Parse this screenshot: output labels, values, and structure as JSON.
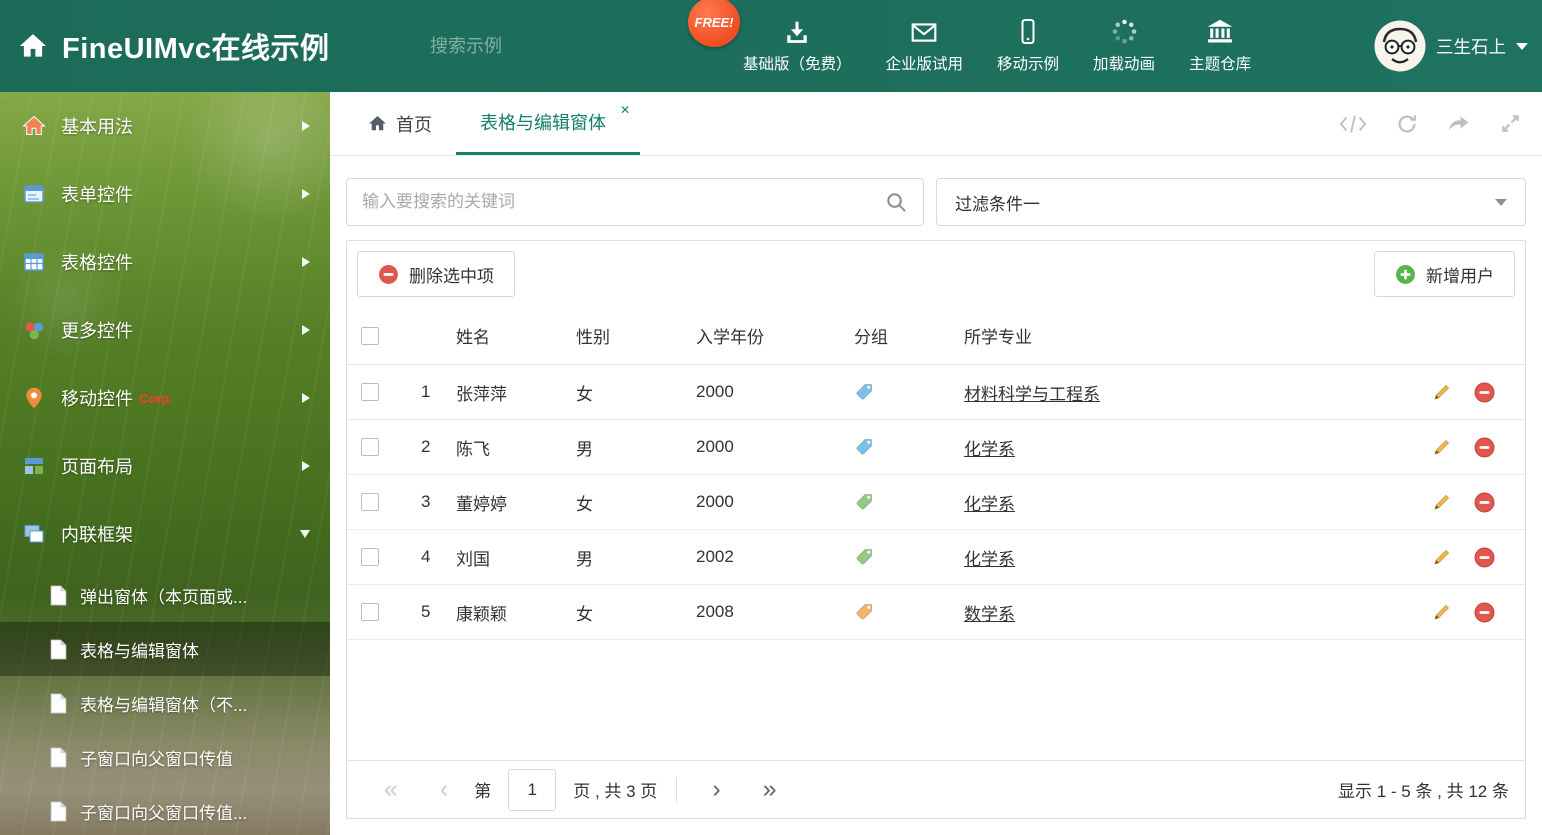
{
  "header": {
    "title": "FineUIMvc在线示例",
    "search_placeholder": "搜索示例",
    "free_badge": "FREE!",
    "nav": [
      {
        "label": "基础版（免费）"
      },
      {
        "label": "企业版试用"
      },
      {
        "label": "移动示例"
      },
      {
        "label": "加载动画"
      },
      {
        "label": "主题仓库"
      }
    ],
    "user_name": "三生石上"
  },
  "sidebar": {
    "items": [
      {
        "label": "基本用法"
      },
      {
        "label": "表单控件"
      },
      {
        "label": "表格控件"
      },
      {
        "label": "更多控件"
      },
      {
        "label": "移动控件",
        "badge": "Corp."
      },
      {
        "label": "页面布局"
      },
      {
        "label": "内联框架"
      }
    ],
    "subitems": [
      {
        "label": "弹出窗体（本页面或..."
      },
      {
        "label": "表格与编辑窗体"
      },
      {
        "label": "表格与编辑窗体（不..."
      },
      {
        "label": "子窗口向父窗口传值"
      },
      {
        "label": "子窗口向父窗口传值..."
      }
    ]
  },
  "tabs": {
    "home_label": "首页",
    "active_label": "表格与编辑窗体",
    "close_glyph": "✕"
  },
  "filters": {
    "search_placeholder": "输入要搜索的关键词",
    "filter_value": "过滤条件一"
  },
  "toolbar": {
    "delete_label": "删除选中项",
    "add_label": "新增用户"
  },
  "table": {
    "columns": {
      "name": "姓名",
      "gender": "性别",
      "year": "入学年份",
      "group": "分组",
      "major": "所学专业"
    },
    "rows": [
      {
        "index": "1",
        "name": "张萍萍",
        "gender": "女",
        "year": "2000",
        "tag_color": "#7cc0ea",
        "major": "材料科学与工程系"
      },
      {
        "index": "2",
        "name": "陈飞",
        "gender": "男",
        "year": "2000",
        "tag_color": "#7cc0ea",
        "major": "化学系"
      },
      {
        "index": "3",
        "name": "董婷婷",
        "gender": "女",
        "year": "2000",
        "tag_color": "#93cb82",
        "major": "化学系"
      },
      {
        "index": "4",
        "name": "刘国",
        "gender": "男",
        "year": "2002",
        "tag_color": "#93cb82",
        "major": "化学系"
      },
      {
        "index": "5",
        "name": "康颖颖",
        "gender": "女",
        "year": "2008",
        "tag_color": "#f3b569",
        "major": "数学系"
      }
    ]
  },
  "pagination": {
    "first_glyph": "«",
    "prev_glyph": "‹",
    "next_glyph": "›",
    "last_glyph": "»",
    "page_prefix": "第",
    "current_page": "1",
    "page_suffix": "页 , 共 3 页",
    "summary": "显示 1 - 5 条 , 共 12 条"
  },
  "colors": {
    "accent": "#12806b",
    "header_bg": "#1d6e5b",
    "danger": "#e2574c",
    "success": "#56b44c"
  }
}
